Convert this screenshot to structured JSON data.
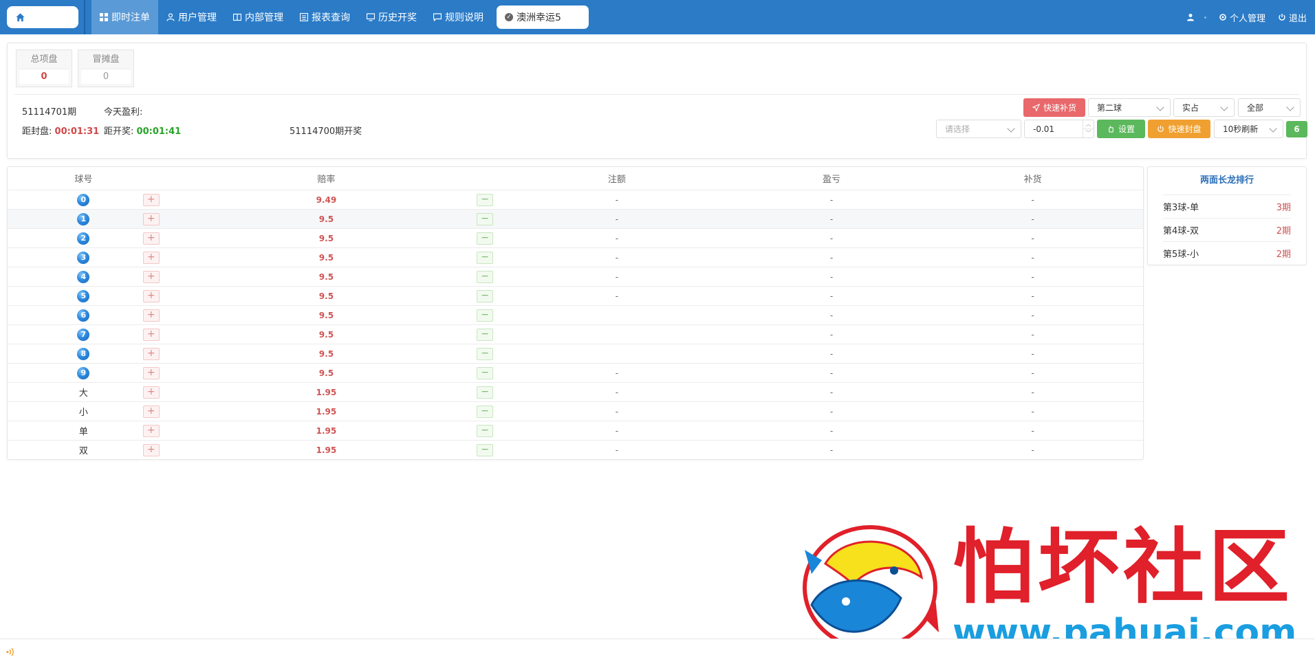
{
  "nav": {
    "items": [
      {
        "label": "即时注单",
        "icon": "grid-icon",
        "active": true
      },
      {
        "label": "用户管理",
        "icon": "user-icon",
        "active": false
      },
      {
        "label": "内部管理",
        "icon": "book-icon",
        "active": false
      },
      {
        "label": "报表查询",
        "icon": "report-icon",
        "active": false
      },
      {
        "label": "历史开奖",
        "icon": "monitor-icon",
        "active": false
      },
      {
        "label": "规则说明",
        "icon": "comment-icon",
        "active": false
      }
    ],
    "game_tab": "澳洲幸运5",
    "right": {
      "personal": "个人管理",
      "logout": "退出"
    }
  },
  "summary": {
    "cards": [
      {
        "label": "总项盘",
        "value": "0",
        "color": "#d04848"
      },
      {
        "label": "冒摊盘",
        "value": "0",
        "color": "#999999"
      }
    ],
    "period": "51114701期",
    "profit_label": "今天盈利:",
    "profit_value": "",
    "close_label": "距封盘:",
    "close_time": "00:01:31",
    "open_label": "距开奖:",
    "open_time": "00:01:41",
    "last_draw": "51114700期开奖"
  },
  "controls": {
    "quick_supply": "快速补货",
    "ball_select": "第二球",
    "mode_select": "实占",
    "scope_select": "全部",
    "choose_placeholder": "请选择",
    "step_value": "-0.01",
    "set_button": "设置",
    "quick_close": "快速封盘",
    "refresh_select": "10秒刷新",
    "countdown": "6"
  },
  "table": {
    "headers": [
      "球号",
      "赔率",
      "注额",
      "盈亏",
      "补货"
    ],
    "rows": [
      {
        "ball": "0",
        "type": "ball",
        "odds": "9.49",
        "bet": "-",
        "pl": "-",
        "supply": "-"
      },
      {
        "ball": "1",
        "type": "ball",
        "odds": "9.5",
        "bet": "-",
        "pl": "-",
        "supply": "-"
      },
      {
        "ball": "2",
        "type": "ball",
        "odds": "9.5",
        "bet": "-",
        "pl": "-",
        "supply": "-"
      },
      {
        "ball": "3",
        "type": "ball",
        "odds": "9.5",
        "bet": "-",
        "pl": "-",
        "supply": "-"
      },
      {
        "ball": "4",
        "type": "ball",
        "odds": "9.5",
        "bet": "-",
        "pl": "-",
        "supply": "-"
      },
      {
        "ball": "5",
        "type": "ball",
        "odds": "9.5",
        "bet": "-",
        "pl": "-",
        "supply": "-"
      },
      {
        "ball": "6",
        "type": "ball",
        "odds": "9.5",
        "bet": "",
        "pl": "-",
        "supply": "-"
      },
      {
        "ball": "7",
        "type": "ball",
        "odds": "9.5",
        "bet": "",
        "pl": "-",
        "supply": "-"
      },
      {
        "ball": "8",
        "type": "ball",
        "odds": "9.5",
        "bet": "",
        "pl": "-",
        "supply": "-"
      },
      {
        "ball": "9",
        "type": "ball",
        "odds": "9.5",
        "bet": "-",
        "pl": "-",
        "supply": "-"
      },
      {
        "ball": "大",
        "type": "text",
        "odds": "1.95",
        "bet": "-",
        "pl": "-",
        "supply": "-"
      },
      {
        "ball": "小",
        "type": "text",
        "odds": "1.95",
        "bet": "-",
        "pl": "-",
        "supply": "-"
      },
      {
        "ball": "单",
        "type": "text",
        "odds": "1.95",
        "bet": "-",
        "pl": "-",
        "supply": "-"
      },
      {
        "ball": "双",
        "type": "text",
        "odds": "1.95",
        "bet": "-",
        "pl": "-",
        "supply": "-"
      }
    ]
  },
  "ranking": {
    "title": "两面长龙排行",
    "items": [
      {
        "name": "第3球-单",
        "count": "3期"
      },
      {
        "name": "第4球-双",
        "count": "2期"
      },
      {
        "name": "第5球-小",
        "count": "2期"
      }
    ]
  },
  "watermark": {
    "text": "怕坏社区",
    "url": "www.pahuai.com"
  },
  "colors": {
    "nav_bg": "#2b7bc7",
    "danger": "#e8686b",
    "success": "#5cb85c",
    "warning": "#f0a030",
    "odds": "#d05454"
  }
}
